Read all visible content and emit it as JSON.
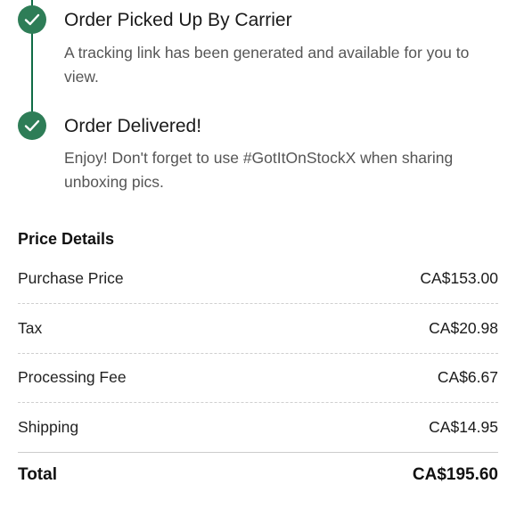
{
  "timeline": {
    "steps": [
      {
        "title": "Order Picked Up By Carrier",
        "description": "A tracking link has been generated and available for you to view."
      },
      {
        "title": "Order Delivered!",
        "description": "Enjoy! Don't forget to use #GotItOnStockX when sharing unboxing pics."
      }
    ],
    "icon": "check-icon",
    "accent_color": "#2e7d57"
  },
  "price_details": {
    "heading": "Price Details",
    "rows": [
      {
        "label": "Purchase Price",
        "value": "CA$153.00"
      },
      {
        "label": "Tax",
        "value": "CA$20.98"
      },
      {
        "label": "Processing Fee",
        "value": "CA$6.67"
      },
      {
        "label": "Shipping",
        "value": "CA$14.95"
      }
    ],
    "total": {
      "label": "Total",
      "value": "CA$195.60"
    }
  }
}
